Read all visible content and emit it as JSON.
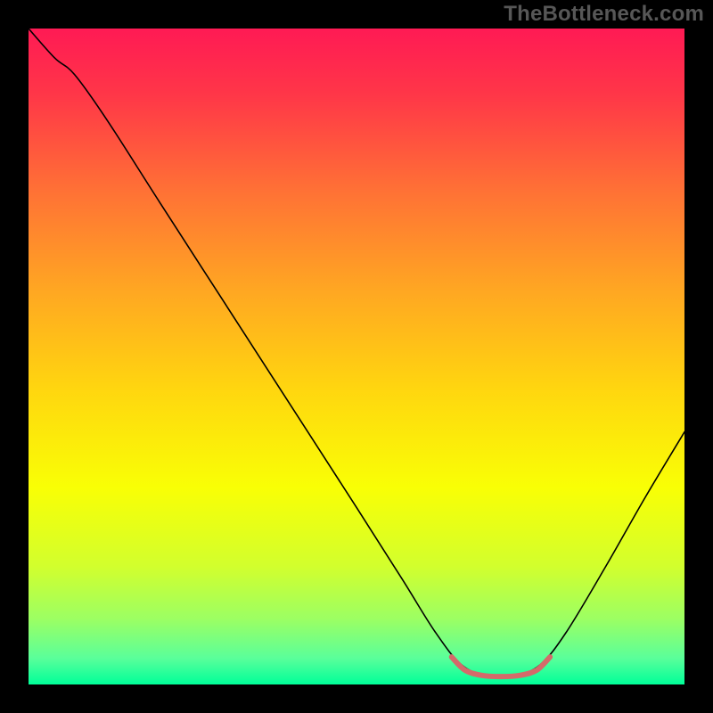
{
  "watermark": "TheBottleneck.com",
  "chart_data": {
    "type": "line",
    "title": "",
    "xlabel": "",
    "ylabel": "",
    "xlim": [
      0,
      100
    ],
    "ylim": [
      0,
      100
    ],
    "background_gradient": {
      "stops": [
        {
          "offset": 0.0,
          "color": "#ff1a54"
        },
        {
          "offset": 0.1,
          "color": "#ff3648"
        },
        {
          "offset": 0.25,
          "color": "#ff7235"
        },
        {
          "offset": 0.4,
          "color": "#ffa722"
        },
        {
          "offset": 0.55,
          "color": "#ffd60f"
        },
        {
          "offset": 0.7,
          "color": "#f9ff05"
        },
        {
          "offset": 0.82,
          "color": "#d2ff2d"
        },
        {
          "offset": 0.9,
          "color": "#9cff63"
        },
        {
          "offset": 0.96,
          "color": "#5aff9a"
        },
        {
          "offset": 1.0,
          "color": "#00ff99"
        }
      ]
    },
    "series": [
      {
        "name": "bottleneck-curve",
        "color": "#000000",
        "width": 1.6,
        "points": [
          {
            "x": 0.0,
            "y": 100.0
          },
          {
            "x": 4.0,
            "y": 95.5
          },
          {
            "x": 7.0,
            "y": 93.0
          },
          {
            "x": 12.0,
            "y": 86.0
          },
          {
            "x": 20.0,
            "y": 73.5
          },
          {
            "x": 30.0,
            "y": 58.0
          },
          {
            "x": 40.0,
            "y": 42.5
          },
          {
            "x": 50.0,
            "y": 27.0
          },
          {
            "x": 57.0,
            "y": 16.0
          },
          {
            "x": 62.0,
            "y": 8.0
          },
          {
            "x": 66.0,
            "y": 3.0
          },
          {
            "x": 70.0,
            "y": 1.2
          },
          {
            "x": 74.0,
            "y": 1.2
          },
          {
            "x": 78.0,
            "y": 3.0
          },
          {
            "x": 82.0,
            "y": 8.0
          },
          {
            "x": 88.0,
            "y": 18.0
          },
          {
            "x": 94.0,
            "y": 28.5
          },
          {
            "x": 100.0,
            "y": 38.5
          }
        ]
      },
      {
        "name": "highlight-segment",
        "color": "#d46a6a",
        "width": 6,
        "points": [
          {
            "x": 64.5,
            "y": 4.2
          },
          {
            "x": 66.5,
            "y": 2.2
          },
          {
            "x": 69.0,
            "y": 1.4
          },
          {
            "x": 72.0,
            "y": 1.2
          },
          {
            "x": 75.0,
            "y": 1.4
          },
          {
            "x": 77.5,
            "y": 2.2
          },
          {
            "x": 79.5,
            "y": 4.2
          }
        ]
      }
    ]
  }
}
